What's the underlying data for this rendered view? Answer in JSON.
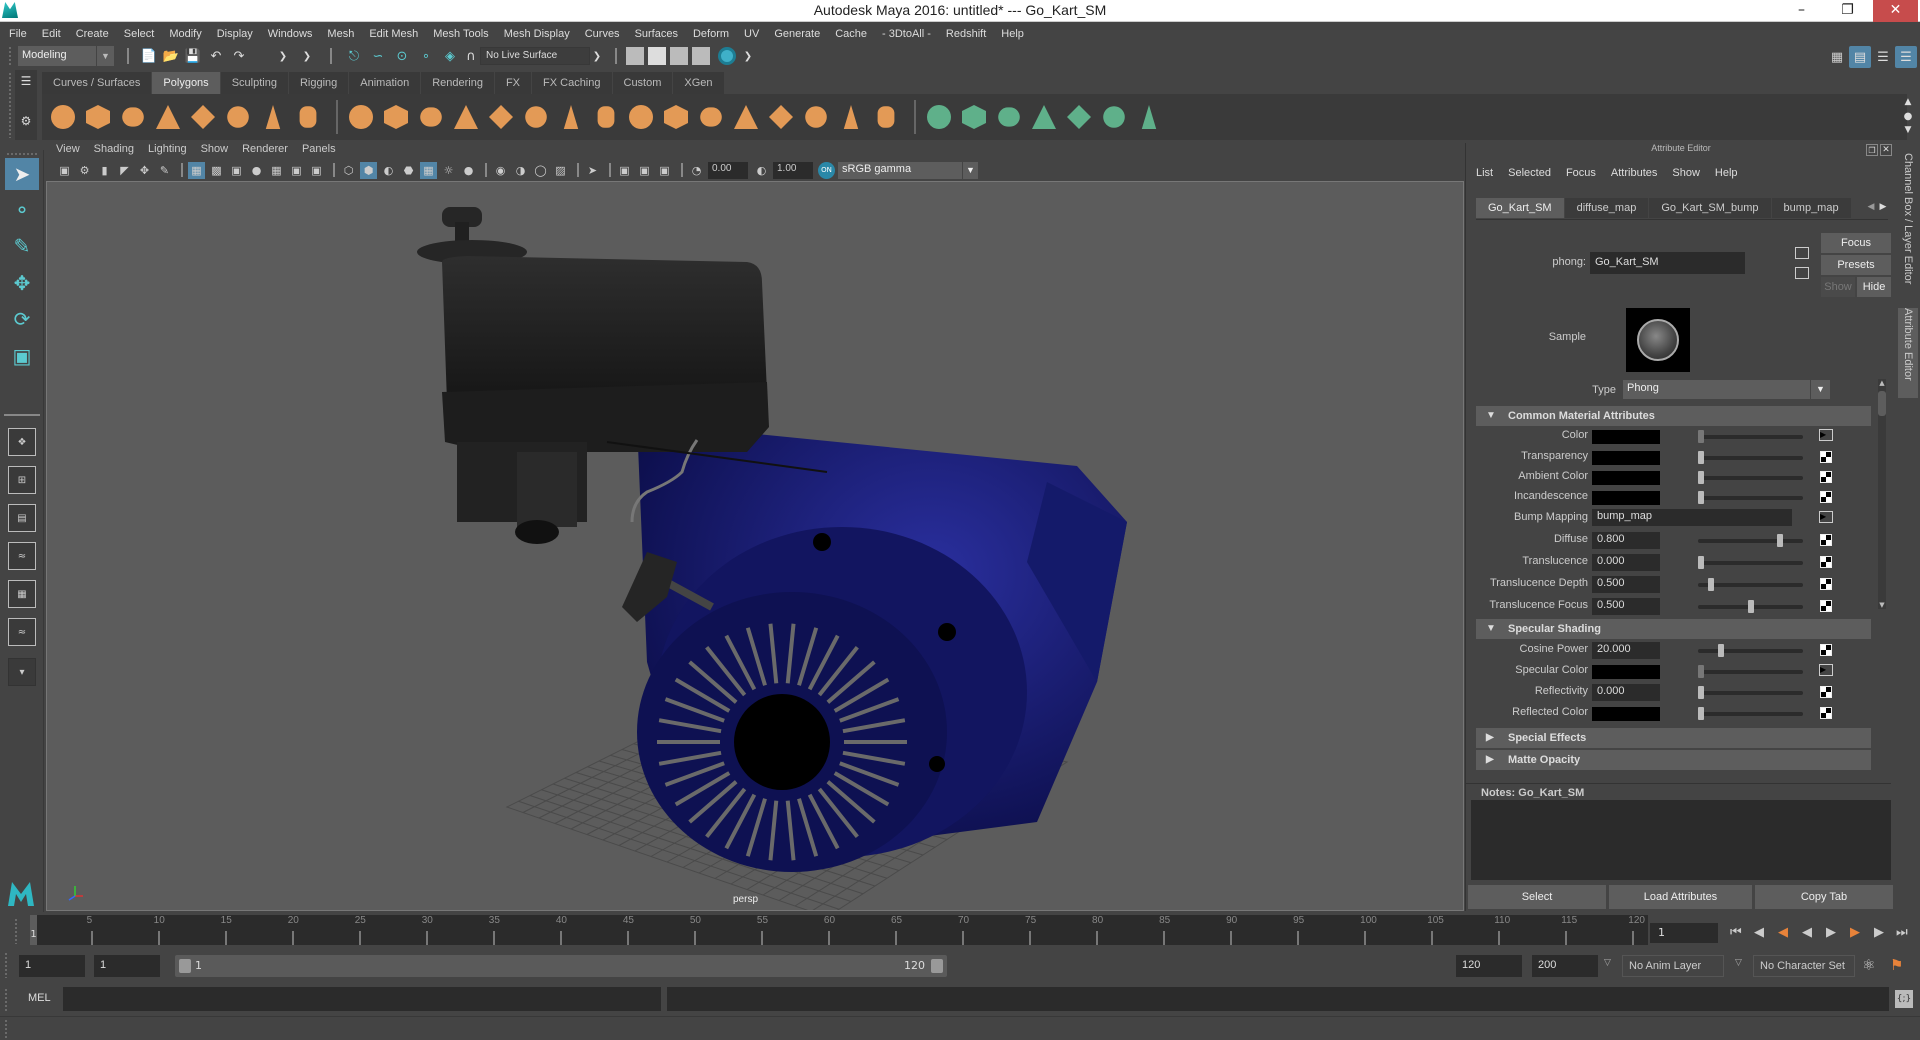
{
  "window": {
    "title": "Autodesk Maya 2016: untitled*   ---   Go_Kart_SM",
    "controls": [
      "minimize",
      "maximize",
      "close"
    ]
  },
  "menubar": [
    "File",
    "Edit",
    "Create",
    "Select",
    "Modify",
    "Display",
    "Windows",
    "Mesh",
    "Edit Mesh",
    "Mesh Tools",
    "Mesh Display",
    "Curves",
    "Surfaces",
    "Deform",
    "UV",
    "Generate",
    "Cache",
    "- 3DtoAll -",
    "Redshift",
    "Help"
  ],
  "statusline": {
    "mode": "Modeling",
    "live_surface": "No Live Surface"
  },
  "shelf": {
    "tabs": [
      "Curves / Surfaces",
      "Polygons",
      "Sculpting",
      "Rigging",
      "Animation",
      "Rendering",
      "FX",
      "FX Caching",
      "Custom",
      "XGen"
    ],
    "active_tab": "Polygons",
    "icons_group1": [
      "poly-sphere-icon",
      "poly-cube-icon",
      "poly-cylinder-icon",
      "poly-cone-icon",
      "poly-plane-icon",
      "poly-torus-icon",
      "poly-pyramid-icon",
      "poly-pipe-icon"
    ],
    "icons_group2": [
      "combine-icon",
      "separate-icon",
      "extract-icon",
      "smooth-icon",
      "mirror-icon",
      "fill-hole-icon",
      "bevel-icon",
      "bridge-icon",
      "append-icon",
      "extrude-icon",
      "merge-icon",
      "multi-cut-icon",
      "target-weld-icon",
      "insert-edge-loop-icon",
      "offset-edge-loop-icon",
      "add-divisions-icon"
    ],
    "icons_group3": [
      "planar-uv-icon",
      "cylindrical-uv-icon",
      "spherical-uv-icon",
      "automatic-uv-icon",
      "contour-stretch-uv-icon",
      "uv-editor-icon",
      "unfold-uv-icon"
    ]
  },
  "viewport": {
    "menu": [
      "View",
      "Shading",
      "Lighting",
      "Show",
      "Renderer",
      "Panels"
    ],
    "exposure": "0.00",
    "gamma": "1.00",
    "color_space": "sRGB gamma",
    "camera_label": "persp"
  },
  "attribute_editor": {
    "title": "Attribute Editor",
    "menu": [
      "List",
      "Selected",
      "Focus",
      "Attributes",
      "Show",
      "Help"
    ],
    "tabs": [
      "Go_Kart_SM",
      "diffuse_map",
      "Go_Kart_SM_bump",
      "bump_map"
    ],
    "active_tab": "Go_Kart_SM",
    "node_type_label": "phong:",
    "node_name": "Go_Kart_SM",
    "buttons": {
      "focus": "Focus",
      "presets": "Presets",
      "show": "Show",
      "hide": "Hide"
    },
    "sample_label": "Sample",
    "type_label": "Type",
    "type_value": "Phong",
    "sections": {
      "common": {
        "title": "Common Material Attributes",
        "attrs": [
          {
            "label": "Color",
            "kind": "color",
            "value": "#000000",
            "slider": 0.0
          },
          {
            "label": "Transparency",
            "kind": "color",
            "value": "#000000",
            "slider": 0.0
          },
          {
            "label": "Ambient Color",
            "kind": "color",
            "value": "#000000",
            "slider": 0.0
          },
          {
            "label": "Incandescence",
            "kind": "color",
            "value": "#000000",
            "slider": 0.0
          },
          {
            "label": "Bump Mapping",
            "kind": "text",
            "value": "bump_map"
          },
          {
            "label": "Diffuse",
            "kind": "number",
            "value": "0.800",
            "slider": 0.8
          },
          {
            "label": "Translucence",
            "kind": "number",
            "value": "0.000",
            "slider": 0.0
          },
          {
            "label": "Translucence Depth",
            "kind": "number",
            "value": "0.500",
            "slider": 0.1
          },
          {
            "label": "Translucence Focus",
            "kind": "number",
            "value": "0.500",
            "slider": 0.5
          }
        ]
      },
      "specular": {
        "title": "Specular Shading",
        "attrs": [
          {
            "label": "Cosine Power",
            "kind": "number",
            "value": "20.000",
            "slider": 0.2
          },
          {
            "label": "Specular Color",
            "kind": "color",
            "value": "#000000",
            "slider": 0.0
          },
          {
            "label": "Reflectivity",
            "kind": "number",
            "value": "0.000",
            "slider": 0.0
          },
          {
            "label": "Reflected Color",
            "kind": "color",
            "value": "#000000",
            "slider": 0.0
          }
        ]
      },
      "special_effects": {
        "title": "Special Effects"
      },
      "matte_opacity": {
        "title": "Matte Opacity"
      }
    },
    "notes_label": "Notes:  Go_Kart_SM",
    "bottom_buttons": {
      "select": "Select",
      "load_attributes": "Load Attributes",
      "copy_tab": "Copy Tab"
    }
  },
  "side_tabs": [
    "Channel Box / Layer Editor",
    "Attribute Editor"
  ],
  "timeline": {
    "start": 1,
    "end": 120,
    "tick_labels": [
      5,
      10,
      15,
      20,
      25,
      30,
      35,
      40,
      45,
      50,
      55,
      60,
      65,
      70,
      75,
      80,
      85,
      90,
      95,
      100,
      105,
      110,
      115,
      120
    ],
    "current_frame": "1",
    "current_frame_marker": "1"
  },
  "range": {
    "anim_start": "1",
    "playback_start": "1",
    "slider_start": "1",
    "slider_end": "120",
    "playback_end": "120",
    "anim_end": "200",
    "anim_layer": "No Anim Layer",
    "character_set": "No Character Set"
  },
  "command_line": {
    "label": "MEL",
    "input": "",
    "output": ""
  },
  "colors": {
    "accent_blue": "#5285a6",
    "shelf_orange": "#e39a56",
    "shelf_green": "#5fb08a",
    "tool_teal": "#5ccad0",
    "engine_blue": "#1a1d7a",
    "close_red": "#c74c4c"
  }
}
